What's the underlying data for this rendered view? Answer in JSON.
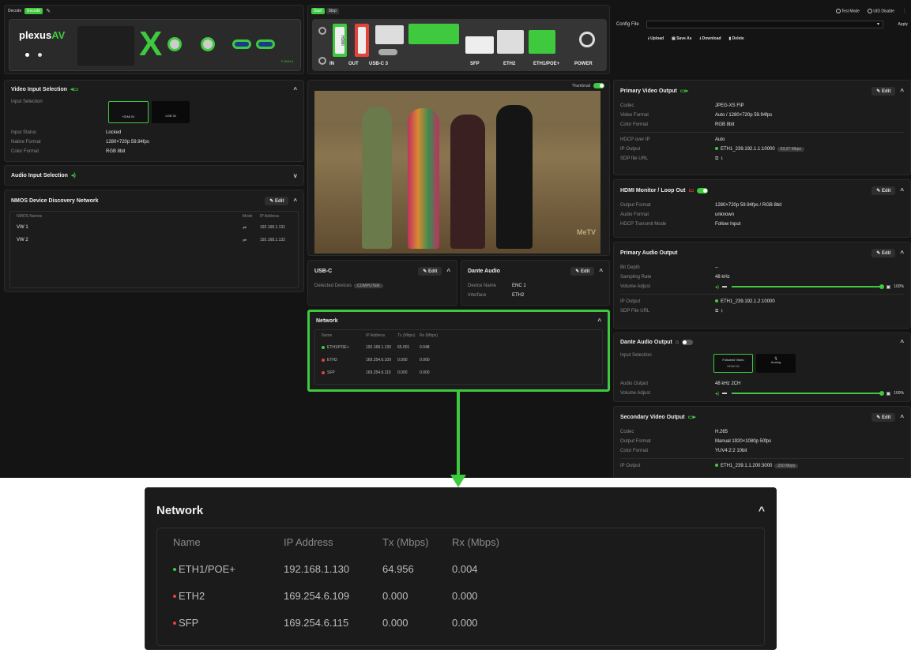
{
  "topbar": {
    "decode_tab": "Decode",
    "encode_tab": "Encode",
    "start": "Start",
    "stop": "Stop",
    "test_mode": "Test Mode",
    "uid_disable": "UID Disable"
  },
  "brand": {
    "plexus": "plexus",
    "av": "AV",
    "hdmi_in": "IN",
    "out": "OUT",
    "p_avn": "P-AVN-4"
  },
  "ports": {
    "in": "IN",
    "out": "OUT",
    "usbc": "USB-C 3",
    "sfp": "SFP",
    "eth2": "ETH2",
    "eth1": "ETH1/POE+",
    "power": "POWER",
    "hdmi_vert": "HDMI"
  },
  "config": {
    "label": "Config File",
    "apply": "Apply",
    "upload": "Upload",
    "save_as": "Save As",
    "download": "Download",
    "delete": "Delete"
  },
  "video_input": {
    "title": "Video Input Selection",
    "input_selection": "Input Selection",
    "hdmi_in": "HDMI IN",
    "usb_in": "USB IN",
    "rows": [
      {
        "k": "Input Status",
        "v": "Locked"
      },
      {
        "k": "Native Format",
        "v": "1280×720p 59.94fps"
      },
      {
        "k": "Color Format",
        "v": "RGB 8bit"
      }
    ]
  },
  "audio_input": {
    "title": "Audio Input Selection"
  },
  "nmos": {
    "title": "NMOS Device Discovery Network",
    "edit": "Edit",
    "col_name": "NMOS Names",
    "col_mode": "Mode",
    "col_ip": "IP Address",
    "rows": [
      {
        "name": "VW 1",
        "ip": "192.168.1.131"
      },
      {
        "name": "VW 2",
        "ip": "192.168.1.132"
      }
    ]
  },
  "thumb": {
    "label": "Thumbnail",
    "watermark": "MeTV"
  },
  "usbc_panel": {
    "title": "USB-C",
    "edit": "Edit",
    "detected": "Detected Devices",
    "device": "COMPUTER"
  },
  "dante": {
    "title": "Dante Audio",
    "edit": "Edit",
    "rows": [
      {
        "k": "Device Name",
        "v": "ENC 1"
      },
      {
        "k": "Interface",
        "v": "ETH2"
      }
    ]
  },
  "network": {
    "title": "Network",
    "cols": [
      "Name",
      "IP Address",
      "Tx (Mbps)",
      "Rx (Mbps)"
    ],
    "rows": [
      {
        "name": "ETH1/POE+",
        "ip": "192.168.1.130",
        "tx": "65.001",
        "rx": "0.048",
        "status": "green"
      },
      {
        "name": "ETH2",
        "ip": "169.254.6.109",
        "tx": "0.000",
        "rx": "0.000",
        "status": "red"
      },
      {
        "name": "SFP",
        "ip": "169.254.6.115",
        "tx": "0.000",
        "rx": "0.000",
        "status": "red"
      }
    ]
  },
  "network_zoom": {
    "title": "Network",
    "cols": [
      "Name",
      "IP Address",
      "Tx (Mbps)",
      "Rx (Mbps)"
    ],
    "rows": [
      {
        "name": "ETH1/POE+",
        "ip": "192.168.1.130",
        "tx": "64.956",
        "rx": "0.004",
        "status": "green"
      },
      {
        "name": "ETH2",
        "ip": "169.254.6.109",
        "tx": "0.000",
        "rx": "0.000",
        "status": "red"
      },
      {
        "name": "SFP",
        "ip": "169.254.6.115",
        "tx": "0.000",
        "rx": "0.000",
        "status": "red"
      }
    ]
  },
  "primary_video": {
    "title": "Primary Video Output",
    "edit": "Edit",
    "rows": [
      {
        "k": "Codec",
        "v": "JPEG-XS FIP"
      },
      {
        "k": "Video Format",
        "v": "Auto / 1280×720p 59.94fps"
      },
      {
        "k": "Color Format",
        "v": "RGB 8bit"
      }
    ],
    "rows2": [
      {
        "k": "HDCP over IP",
        "v": "Auto"
      },
      {
        "k": "IP Output",
        "v": "ETH1_239.192.1.1:10000",
        "badge": "53.27 Mbps"
      },
      {
        "k": "SDP file URL",
        "v": ""
      }
    ]
  },
  "hdmi_monitor": {
    "title": "HDMI Monitor / Loop Out",
    "edit": "Edit",
    "rows": [
      {
        "k": "Output Format",
        "v": "1280×720p 59.94fps / RGB 8bit"
      },
      {
        "k": "Audio Format",
        "v": "unknown"
      },
      {
        "k": "HDCP Transmit Mode",
        "v": "Follow Input"
      }
    ]
  },
  "primary_audio": {
    "title": "Primary Audio Output",
    "edit": "Edit",
    "rows": [
      {
        "k": "Bit Depth",
        "v": "--"
      },
      {
        "k": "Sampling Rate",
        "v": "48 kHz"
      }
    ],
    "volume_label": "Volume Adjust",
    "volume_pct": "100%",
    "volume_level": 1.0,
    "ip_label": "IP Output",
    "ip_value": "ETH1_239.192.1.2:10000",
    "sdp_label": "SDP File URL"
  },
  "dante_out": {
    "title": "Dante Audio Output",
    "input_selection": "Input Selection",
    "followed_video": "Followed Video",
    "hdmi_in": "HDMI IN",
    "analog": "Analog",
    "audio_output_label": "Audio Output",
    "audio_output": "48 kHz 2CH",
    "volume_label": "Volume Adjust",
    "volume_pct": "100%",
    "volume_level": 1.0
  },
  "secondary_video": {
    "title": "Secondary Video Output",
    "edit": "Edit",
    "rows": [
      {
        "k": "Codec",
        "v": "H.265"
      },
      {
        "k": "Output Format",
        "v": "Manual 1920×1080p 50fps"
      },
      {
        "k": "Color Format",
        "v": "YUV4:2:2 10bit"
      }
    ],
    "ip_label": "IP Output",
    "ip_value": "ETH1_239.1.1.200:3000",
    "ip_badge": "250 Mbps"
  },
  "colors": {
    "accent": "#3fc93f",
    "status_red": "#e0443c",
    "link_blue": "#5a8fd8"
  }
}
